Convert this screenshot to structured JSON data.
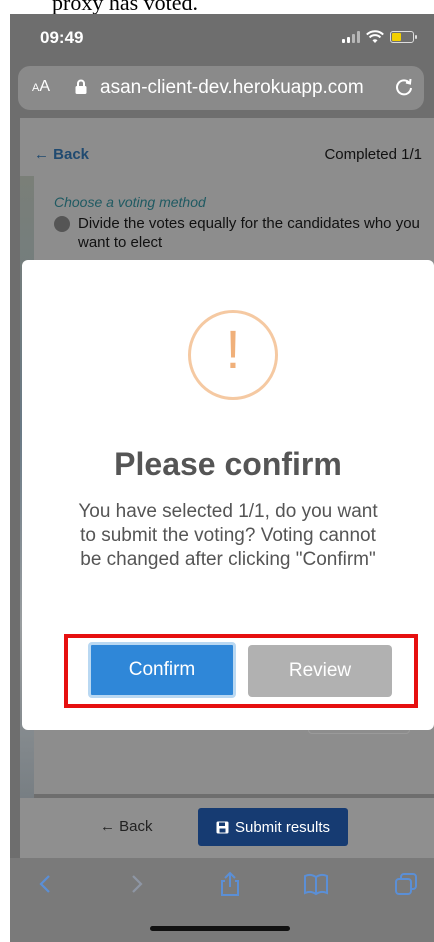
{
  "top_strip": {
    "text": "proxy has voted."
  },
  "status_bar": {
    "time": "09:49"
  },
  "browser": {
    "text_size_button": "AA",
    "url": "asan-client-dev.herokuapp.com"
  },
  "page": {
    "back_label": "← Back",
    "progress_label": "Completed 1/1",
    "section_heading": "Choose a voting method",
    "option_text": "Divide the votes equally for the candidates who you want to elect"
  },
  "modal": {
    "icon_glyph": "!",
    "title": "Please confirm",
    "message": "You have selected 1/1, do you want to submit the voting? Voting cannot be changed after clicking \"Confirm\"",
    "confirm_label": "Confirm",
    "review_label": "Review"
  },
  "footer": {
    "back_label": "← Back",
    "submit_label": "Submit results"
  },
  "colors": {
    "confirm": "#2f87d8",
    "review": "#b1b1b1",
    "warning": "#f0b07a",
    "highlight": "#e61010",
    "submit": "#163b72"
  },
  "icons": [
    "lock-icon",
    "reload-icon",
    "floppy-disk-icon",
    "chevron-left-icon",
    "chevron-right-icon",
    "share-icon",
    "bookmarks-icon",
    "tabs-icon"
  ]
}
